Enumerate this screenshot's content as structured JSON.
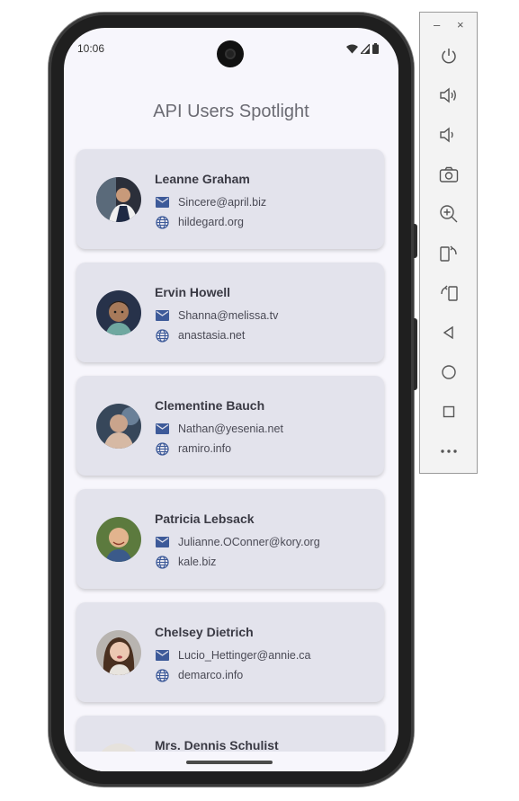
{
  "status_bar": {
    "time": "10:06"
  },
  "app": {
    "title": "API Users Spotlight"
  },
  "users": [
    {
      "name": "Leanne Graham",
      "email": "Sincere@april.biz",
      "website": "hildegard.org"
    },
    {
      "name": "Ervin Howell",
      "email": "Shanna@melissa.tv",
      "website": "anastasia.net"
    },
    {
      "name": "Clementine Bauch",
      "email": "Nathan@yesenia.net",
      "website": "ramiro.info"
    },
    {
      "name": "Patricia Lebsack",
      "email": "Julianne.OConner@kory.org",
      "website": "kale.biz"
    },
    {
      "name": "Chelsey Dietrich",
      "email": "Lucio_Hettinger@annie.ca",
      "website": "demarco.info"
    },
    {
      "name": "Mrs. Dennis Schulist",
      "email": "",
      "website": ""
    }
  ],
  "emulator_toolbar": {
    "minimize": "–",
    "close": "×",
    "buttons": [
      "power-icon",
      "volume-up-icon",
      "volume-down-icon",
      "camera-icon",
      "zoom-in-icon",
      "rotate-left-icon",
      "rotate-right-icon",
      "back-icon",
      "home-icon",
      "overview-icon",
      "more-icon"
    ]
  },
  "colors": {
    "card_bg": "#e3e3ec",
    "screen_bg": "#f7f6fc",
    "icon_accent": "#3d5a99"
  }
}
